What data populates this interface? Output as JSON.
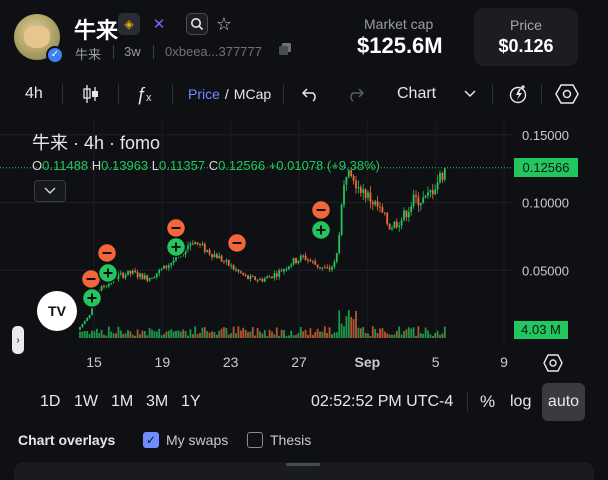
{
  "header": {
    "token_name": "牛来",
    "chain_icon": "bnb-chain-icon",
    "ticker": "牛来",
    "age": "3w",
    "address": "0xbeea...377777",
    "market_cap_label": "Market cap",
    "market_cap_value": "$125.6M",
    "price_label": "Price",
    "price_value": "$0.126"
  },
  "toolbar": {
    "interval": "4h",
    "price_label": "Price",
    "mcap_label": "MCap",
    "separator": "/",
    "chart_type": "Chart"
  },
  "chart_header": {
    "title": "牛来 · 4h · fomo",
    "o_label": "O",
    "o_value": "0.11488",
    "h_label": "H",
    "h_value": "0.13963",
    "l_label": "L",
    "l_value": "0.11357",
    "c_label": "C",
    "c_value": "0.12566",
    "change": "+0.01078 (+9.38%)"
  },
  "price_tag": "0.12566",
  "volume_tag": "4.03 M",
  "tv_logo": "TV",
  "chart_data": {
    "type": "candlestick",
    "x_ticks": [
      "15",
      "19",
      "23",
      "27",
      "Sep",
      "5",
      "9"
    ],
    "y_ticks": [
      "0.15000",
      "0.10000",
      "0.05000"
    ],
    "ylim": [
      0.0,
      0.155
    ],
    "last_price": 0.12566,
    "colors": {
      "up": "#22c55e",
      "down": "#ef6b3a"
    }
  },
  "range": {
    "options": [
      "1D",
      "1W",
      "1M",
      "3M",
      "1Y"
    ],
    "time": "02:52:52 PM UTC-4",
    "percent_label": "%",
    "log_label": "log",
    "auto_label": "auto"
  },
  "overlays": {
    "title": "Chart overlays",
    "my_swaps_label": "My swaps",
    "my_swaps_checked": true,
    "thesis_label": "Thesis",
    "thesis_checked": false
  }
}
